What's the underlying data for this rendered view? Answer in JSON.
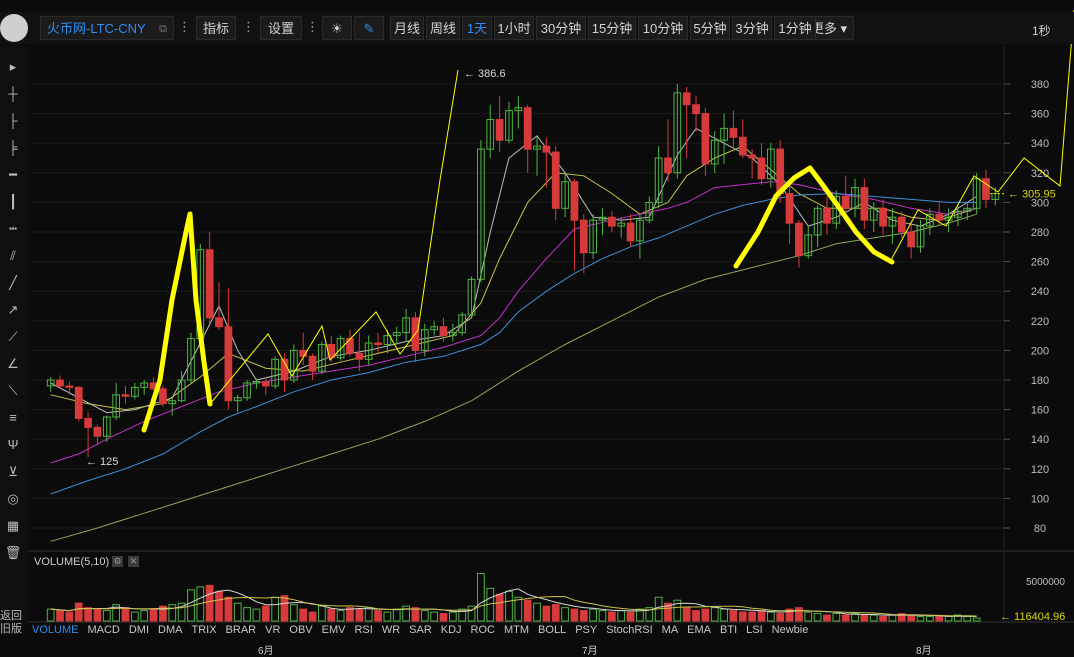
{
  "toolbar": {
    "symbol": "火币网-LTC-CNY",
    "indicators_label": "指标",
    "settings_label": "设置",
    "periods": [
      "月线",
      "周线",
      "1天",
      "1小时",
      "30分钟",
      "15分钟",
      "10分钟",
      "5分钟",
      "3分钟",
      "1分钟"
    ],
    "active_period": "1天",
    "more_label": "更多",
    "interval_label": "1秒"
  },
  "left_tools": [
    "cursor-arrow-icon",
    "crosshair-icon",
    "line-segment-icon",
    "horizontal-ray-icon",
    "horizontal-line-icon",
    "vertical-line-icon",
    "dotted-line-icon",
    "parallel-channel-icon",
    "trend-line-icon",
    "arrow-line-icon",
    "extended-line-icon",
    "angle-line-icon",
    "fib-fan-icon",
    "fib-retracement-icon",
    "pitchfork-icon",
    "gann-fan-icon",
    "spiral-icon",
    "pattern-icon",
    "trash-icon"
  ],
  "back_label": "返回旧版",
  "volume_title": "VOLUME(5,10)",
  "indicator_tabs": [
    "VOLUME",
    "MACD",
    "DMI",
    "DMA",
    "TRIX",
    "BRAR",
    "VR",
    "OBV",
    "EMV",
    "RSI",
    "WR",
    "SAR",
    "KDJ",
    "ROC",
    "MTM",
    "BOLL",
    "PSY",
    "StochRSI",
    "MA",
    "EMA",
    "BTI",
    "LSI",
    "Newbie"
  ],
  "active_tab": "VOLUME",
  "months": [
    "6月",
    "7月",
    "8月"
  ],
  "chart_data": {
    "type": "candlestick",
    "y_ticks": [
      80,
      100,
      120,
      140,
      160,
      180,
      200,
      220,
      240,
      260,
      280,
      300,
      320,
      340,
      360,
      380
    ],
    "ylim": [
      67,
      398
    ],
    "annotations": {
      "high_label": "386.6",
      "low_label": "125",
      "last_price": "305.95",
      "last_volume": "116404.96",
      "volume_tick": "5000000"
    },
    "colors": {
      "up": "#4fb343",
      "down": "#d63a3a",
      "ma5": "#bdbdbd",
      "ma10": "#c9c24a",
      "ma20": "#c032c8",
      "ma30": "#3d8fd8",
      "ma60": "#8aa85a",
      "drawing": "#ffff00",
      "price_line": "#d8d800"
    },
    "candles": [
      [
        176,
        182,
        172,
        180
      ],
      [
        180,
        183,
        174,
        176
      ],
      [
        176,
        179,
        170,
        175
      ],
      [
        175,
        176,
        152,
        154
      ],
      [
        154,
        158,
        128,
        148
      ],
      [
        148,
        150,
        136,
        142
      ],
      [
        142,
        156,
        138,
        155
      ],
      [
        155,
        178,
        153,
        170
      ],
      [
        170,
        176,
        164,
        169
      ],
      [
        169,
        178,
        167,
        175
      ],
      [
        175,
        180,
        170,
        178
      ],
      [
        178,
        182,
        173,
        174
      ],
      [
        174,
        176,
        162,
        164
      ],
      [
        164,
        168,
        156,
        166
      ],
      [
        166,
        186,
        165,
        180
      ],
      [
        180,
        212,
        178,
        208
      ],
      [
        208,
        272,
        206,
        268
      ],
      [
        268,
        280,
        218,
        222
      ],
      [
        222,
        246,
        214,
        216
      ],
      [
        216,
        242,
        160,
        166
      ],
      [
        166,
        170,
        158,
        168
      ],
      [
        168,
        180,
        166,
        178
      ],
      [
        178,
        181,
        174,
        179
      ],
      [
        179,
        182,
        170,
        176
      ],
      [
        176,
        196,
        174,
        194
      ],
      [
        194,
        198,
        172,
        180
      ],
      [
        180,
        204,
        178,
        200
      ],
      [
        200,
        212,
        190,
        196
      ],
      [
        196,
        198,
        180,
        186
      ],
      [
        186,
        206,
        184,
        204
      ],
      [
        204,
        210,
        192,
        195
      ],
      [
        195,
        210,
        193,
        208
      ],
      [
        208,
        214,
        196,
        198
      ],
      [
        198,
        212,
        186,
        194
      ],
      [
        194,
        210,
        190,
        205
      ],
      [
        205,
        212,
        198,
        204
      ],
      [
        204,
        214,
        198,
        210
      ],
      [
        210,
        216,
        204,
        212
      ],
      [
        212,
        228,
        206,
        222
      ],
      [
        222,
        226,
        192,
        200
      ],
      [
        200,
        218,
        196,
        214
      ],
      [
        214,
        220,
        210,
        216
      ],
      [
        216,
        222,
        206,
        210
      ],
      [
        210,
        218,
        206,
        212
      ],
      [
        212,
        226,
        210,
        224
      ],
      [
        224,
        250,
        222,
        248
      ],
      [
        248,
        342,
        246,
        336
      ],
      [
        336,
        366,
        330,
        356
      ],
      [
        356,
        372,
        334,
        342
      ],
      [
        342,
        368,
        340,
        362
      ],
      [
        362,
        372,
        350,
        364
      ],
      [
        364,
        366,
        320,
        336
      ],
      [
        336,
        344,
        318,
        338
      ],
      [
        338,
        344,
        310,
        334
      ],
      [
        334,
        338,
        288,
        296
      ],
      [
        296,
        320,
        290,
        314
      ],
      [
        314,
        316,
        254,
        288
      ],
      [
        288,
        292,
        252,
        266
      ],
      [
        266,
        292,
        262,
        288
      ],
      [
        288,
        296,
        278,
        290
      ],
      [
        290,
        294,
        280,
        284
      ],
      [
        284,
        290,
        276,
        286
      ],
      [
        286,
        292,
        270,
        274
      ],
      [
        274,
        292,
        262,
        288
      ],
      [
        288,
        304,
        286,
        300
      ],
      [
        300,
        338,
        296,
        330
      ],
      [
        330,
        356,
        314,
        320
      ],
      [
        320,
        380,
        316,
        374
      ],
      [
        374,
        378,
        330,
        366
      ],
      [
        366,
        372,
        348,
        360
      ],
      [
        360,
        364,
        318,
        326
      ],
      [
        326,
        348,
        320,
        342
      ],
      [
        342,
        360,
        326,
        350
      ],
      [
        350,
        362,
        336,
        344
      ],
      [
        344,
        356,
        330,
        332
      ],
      [
        332,
        336,
        316,
        330
      ],
      [
        330,
        340,
        312,
        316
      ],
      [
        316,
        340,
        310,
        336
      ],
      [
        336,
        342,
        300,
        306
      ],
      [
        306,
        312,
        272,
        286
      ],
      [
        286,
        288,
        256,
        264
      ],
      [
        264,
        284,
        262,
        278
      ],
      [
        278,
        298,
        270,
        296
      ],
      [
        296,
        304,
        278,
        286
      ],
      [
        286,
        308,
        282,
        304
      ],
      [
        304,
        318,
        290,
        296
      ],
      [
        296,
        316,
        290,
        310
      ],
      [
        310,
        316,
        282,
        288
      ],
      [
        288,
        300,
        280,
        296
      ],
      [
        296,
        302,
        278,
        284
      ],
      [
        284,
        296,
        272,
        290
      ],
      [
        290,
        294,
        276,
        280
      ],
      [
        280,
        286,
        262,
        270
      ],
      [
        270,
        288,
        266,
        284
      ],
      [
        284,
        296,
        278,
        292
      ],
      [
        292,
        300,
        284,
        288
      ],
      [
        288,
        296,
        280,
        290
      ],
      [
        290,
        298,
        284,
        294
      ],
      [
        294,
        300,
        288,
        296
      ],
      [
        296,
        320,
        292,
        316
      ],
      [
        316,
        322,
        296,
        302
      ],
      [
        302,
        310,
        298,
        306
      ]
    ],
    "ma": {
      "ma5": [
        [
          0,
          178
        ],
        [
          3,
          168
        ],
        [
          6,
          158
        ],
        [
          9,
          160
        ],
        [
          13,
          168
        ],
        [
          16,
          205
        ],
        [
          18,
          230
        ],
        [
          20,
          200
        ],
        [
          22,
          180
        ],
        [
          26,
          186
        ],
        [
          30,
          196
        ],
        [
          34,
          200
        ],
        [
          38,
          206
        ],
        [
          42,
          210
        ],
        [
          45,
          222
        ],
        [
          47,
          280
        ],
        [
          49,
          330
        ],
        [
          52,
          345
        ],
        [
          55,
          320
        ],
        [
          58,
          290
        ],
        [
          61,
          288
        ],
        [
          64,
          290
        ],
        [
          67,
          332
        ],
        [
          69,
          350
        ],
        [
          72,
          340
        ],
        [
          75,
          330
        ],
        [
          78,
          312
        ],
        [
          81,
          284
        ],
        [
          84,
          290
        ],
        [
          87,
          300
        ],
        [
          90,
          288
        ],
        [
          93,
          284
        ],
        [
          96,
          292
        ],
        [
          99,
          304
        ]
      ],
      "ma10": [
        [
          0,
          170
        ],
        [
          4,
          164
        ],
        [
          8,
          160
        ],
        [
          12,
          164
        ],
        [
          16,
          182
        ],
        [
          19,
          198
        ],
        [
          23,
          188
        ],
        [
          27,
          186
        ],
        [
          31,
          192
        ],
        [
          35,
          198
        ],
        [
          39,
          204
        ],
        [
          43,
          210
        ],
        [
          46,
          232
        ],
        [
          48,
          262
        ],
        [
          51,
          300
        ],
        [
          54,
          320
        ],
        [
          57,
          318
        ],
        [
          60,
          306
        ],
        [
          63,
          292
        ],
        [
          66,
          300
        ],
        [
          68,
          318
        ],
        [
          71,
          330
        ],
        [
          74,
          338
        ],
        [
          77,
          322
        ],
        [
          80,
          306
        ],
        [
          83,
          296
        ],
        [
          86,
          296
        ],
        [
          89,
          296
        ],
        [
          92,
          290
        ],
        [
          95,
          288
        ],
        [
          99,
          296
        ]
      ],
      "ma20": [
        [
          0,
          124
        ],
        [
          3,
          130
        ],
        [
          6,
          140
        ],
        [
          10,
          152
        ],
        [
          14,
          162
        ],
        [
          18,
          172
        ],
        [
          22,
          178
        ],
        [
          26,
          182
        ],
        [
          30,
          186
        ],
        [
          34,
          190
        ],
        [
          38,
          196
        ],
        [
          42,
          202
        ],
        [
          46,
          210
        ],
        [
          48,
          222
        ],
        [
          50,
          240
        ],
        [
          53,
          262
        ],
        [
          56,
          282
        ],
        [
          60,
          288
        ],
        [
          63,
          292
        ],
        [
          66,
          296
        ],
        [
          68,
          300
        ],
        [
          71,
          310
        ],
        [
          74,
          312
        ],
        [
          77,
          314
        ],
        [
          80,
          312
        ],
        [
          84,
          306
        ],
        [
          88,
          302
        ],
        [
          92,
          296
        ],
        [
          96,
          292
        ],
        [
          99,
          296
        ]
      ],
      "ma30": [
        [
          0,
          103
        ],
        [
          4,
          112
        ],
        [
          8,
          120
        ],
        [
          12,
          130
        ],
        [
          16,
          145
        ],
        [
          19,
          155
        ],
        [
          22,
          162
        ],
        [
          26,
          172
        ],
        [
          30,
          180
        ],
        [
          34,
          185
        ],
        [
          38,
          192
        ],
        [
          42,
          196
        ],
        [
          46,
          204
        ],
        [
          48,
          212
        ],
        [
          50,
          226
        ],
        [
          53,
          240
        ],
        [
          56,
          252
        ],
        [
          59,
          262
        ],
        [
          62,
          270
        ],
        [
          65,
          276
        ],
        [
          68,
          284
        ],
        [
          71,
          292
        ],
        [
          74,
          298
        ],
        [
          77,
          302
        ],
        [
          80,
          305
        ],
        [
          84,
          306
        ],
        [
          88,
          304
        ],
        [
          92,
          302
        ],
        [
          96,
          300
        ],
        [
          99,
          300
        ]
      ],
      "ma60": [
        [
          0,
          71
        ],
        [
          5,
          80
        ],
        [
          10,
          90
        ],
        [
          15,
          100
        ],
        [
          20,
          110
        ],
        [
          25,
          120
        ],
        [
          30,
          130
        ],
        [
          35,
          140
        ],
        [
          40,
          152
        ],
        [
          45,
          166
        ],
        [
          50,
          186
        ],
        [
          55,
          204
        ],
        [
          60,
          220
        ],
        [
          65,
          236
        ],
        [
          70,
          248
        ],
        [
          75,
          256
        ],
        [
          80,
          264
        ],
        [
          84,
          272
        ],
        [
          88,
          276
        ],
        [
          92,
          280
        ],
        [
          96,
          286
        ],
        [
          99,
          292
        ]
      ]
    },
    "volumes": [
      0.8,
      0.7,
      0.6,
      1.2,
      0.9,
      0.8,
      0.7,
      1.1,
      0.9,
      0.6,
      0.7,
      0.8,
      1.0,
      1.1,
      1.2,
      2.1,
      2.3,
      2.4,
      2.0,
      1.6,
      1.2,
      0.9,
      0.8,
      1.0,
      1.6,
      1.7,
      1.1,
      0.8,
      0.6,
      1.0,
      0.8,
      0.7,
      0.9,
      0.8,
      0.9,
      0.7,
      0.6,
      0.8,
      1.0,
      0.9,
      0.7,
      0.6,
      0.5,
      0.6,
      0.8,
      1.0,
      3.2,
      2.2,
      1.8,
      2.0,
      1.6,
      1.4,
      1.2,
      1.0,
      1.1,
      0.9,
      0.8,
      0.7,
      0.8,
      0.7,
      0.6,
      0.7,
      0.6,
      0.8,
      0.9,
      1.6,
      1.2,
      1.4,
      0.9,
      0.7,
      0.8,
      0.9,
      0.8,
      0.7,
      0.6,
      0.6,
      0.7,
      0.6,
      0.5,
      0.8,
      0.9,
      0.6,
      0.5,
      0.4,
      0.5,
      0.4,
      0.5,
      0.4,
      0.4,
      0.3,
      0.4,
      0.5,
      0.4,
      0.3,
      0.3,
      0.3,
      0.3,
      0.4,
      0.3,
      0.2
    ]
  }
}
